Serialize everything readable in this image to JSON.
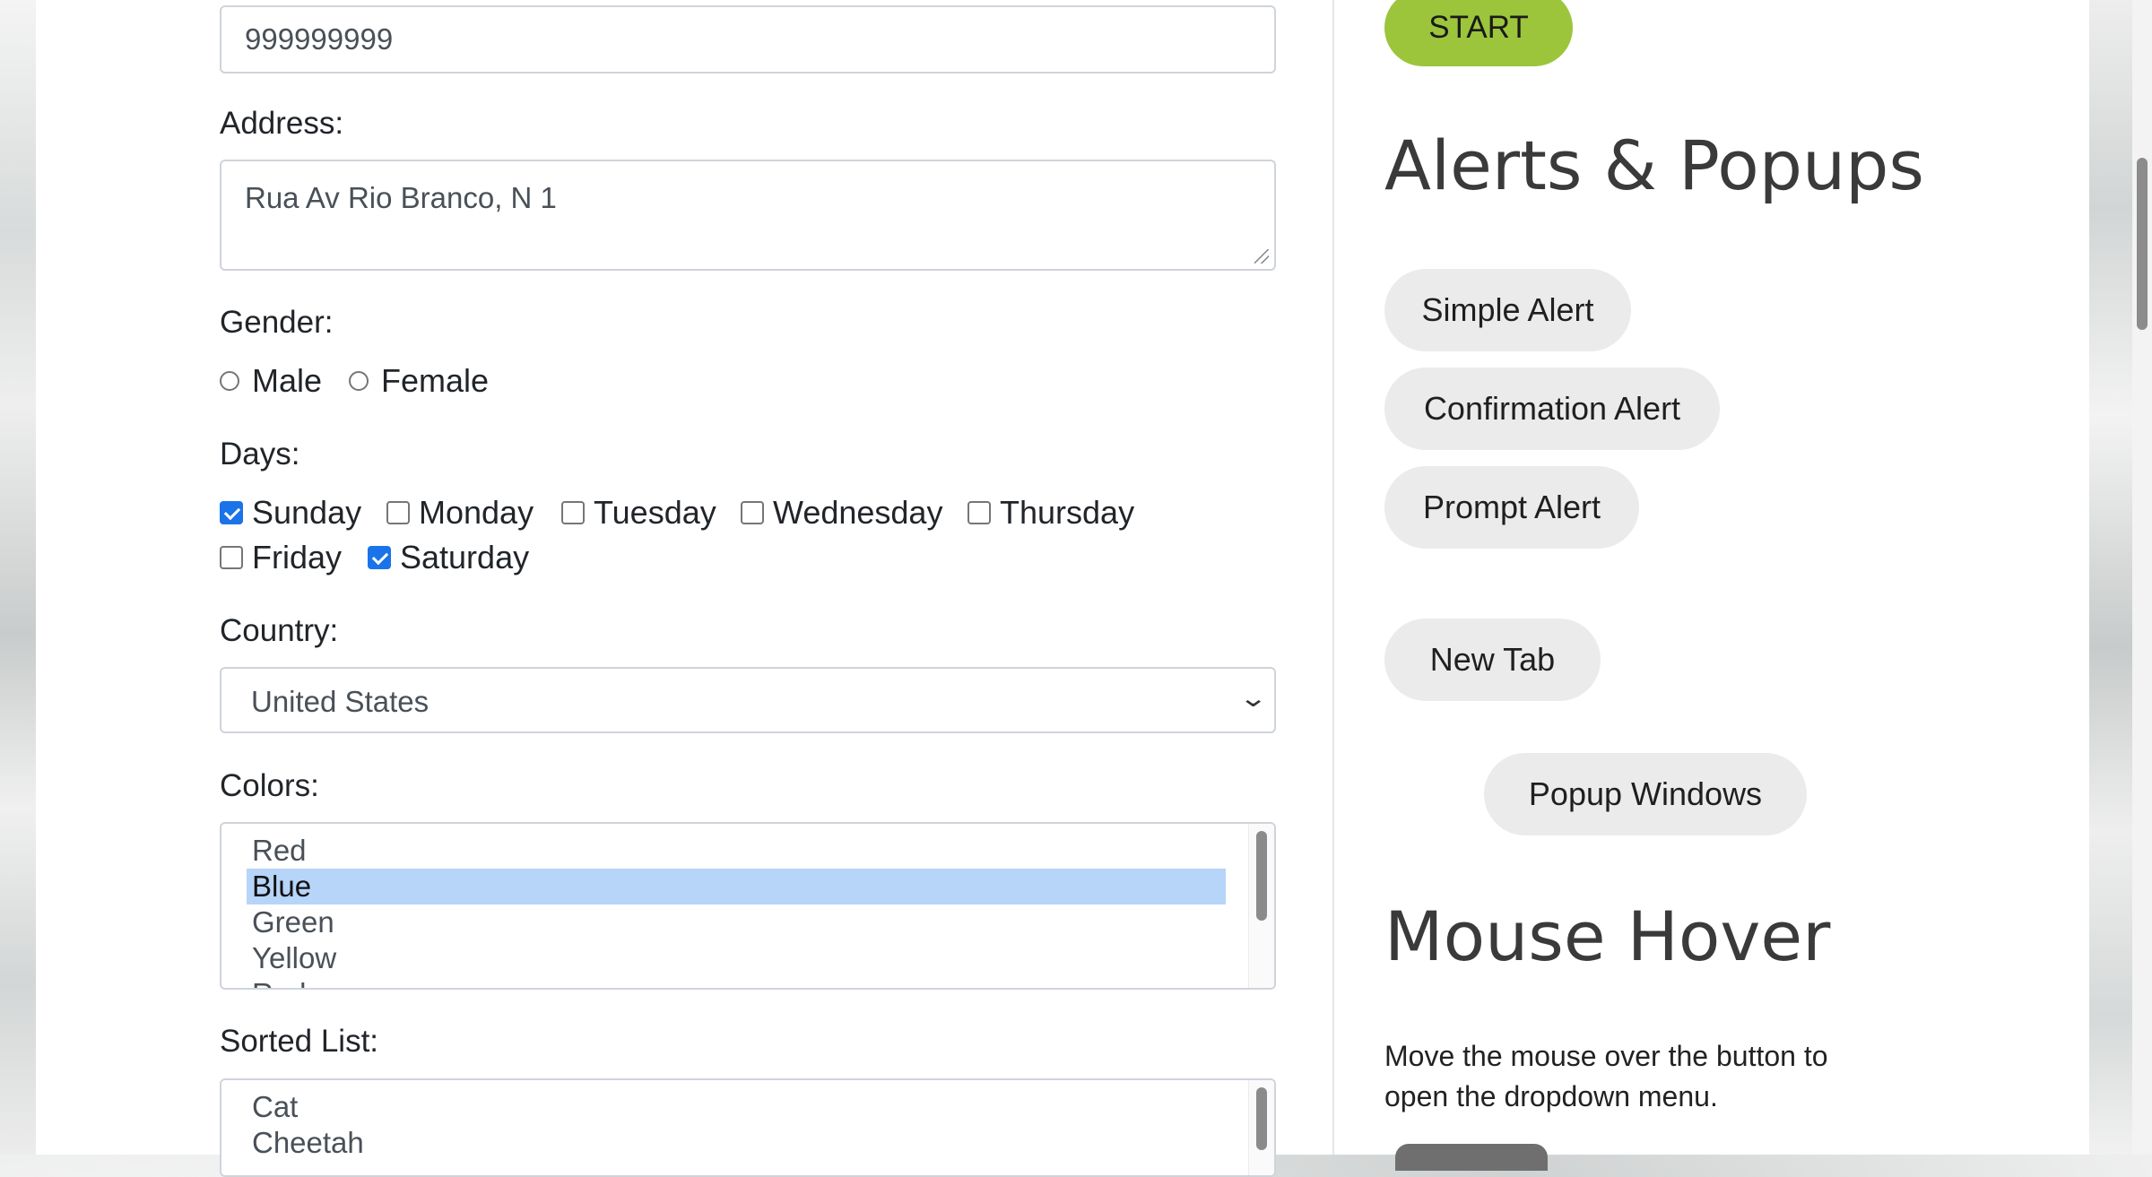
{
  "form": {
    "phone_value": "999999999",
    "address_label": "Address:",
    "address_value": "Rua Av Rio Branco, N 1",
    "gender_label": "Gender:",
    "gender_options": [
      "Male",
      "Female"
    ],
    "days_label": "Days:",
    "days": [
      {
        "label": "Sunday",
        "checked": true
      },
      {
        "label": "Monday",
        "checked": false
      },
      {
        "label": "Tuesday",
        "checked": false
      },
      {
        "label": "Wednesday",
        "checked": false
      },
      {
        "label": "Thursday",
        "checked": false
      },
      {
        "label": "Friday",
        "checked": false
      },
      {
        "label": "Saturday",
        "checked": true
      }
    ],
    "country_label": "Country:",
    "country_value": "United States",
    "colors_label": "Colors:",
    "colors": [
      "Red",
      "Blue",
      "Green",
      "Yellow",
      "Red"
    ],
    "colors_selected": "Blue",
    "sorted_label": "Sorted List:",
    "sorted_list": [
      "Cat",
      "Cheetah"
    ]
  },
  "sidebar": {
    "start_label": "START",
    "alerts_heading": "Alerts & Popups",
    "simple_alert": "Simple Alert",
    "confirmation_alert": "Confirmation Alert",
    "prompt_alert": "Prompt Alert",
    "new_tab": "New Tab",
    "popup_windows": "Popup Windows",
    "mouse_hover_heading": "Mouse Hover",
    "mouse_hover_text": "Move the mouse over the button to open the dropdown menu."
  },
  "colors": {
    "start_green": "#9cc53c",
    "pill_gray": "#ebebeb",
    "selection_blue": "#b7d4f9",
    "checkbox_blue": "#1a73e8"
  }
}
